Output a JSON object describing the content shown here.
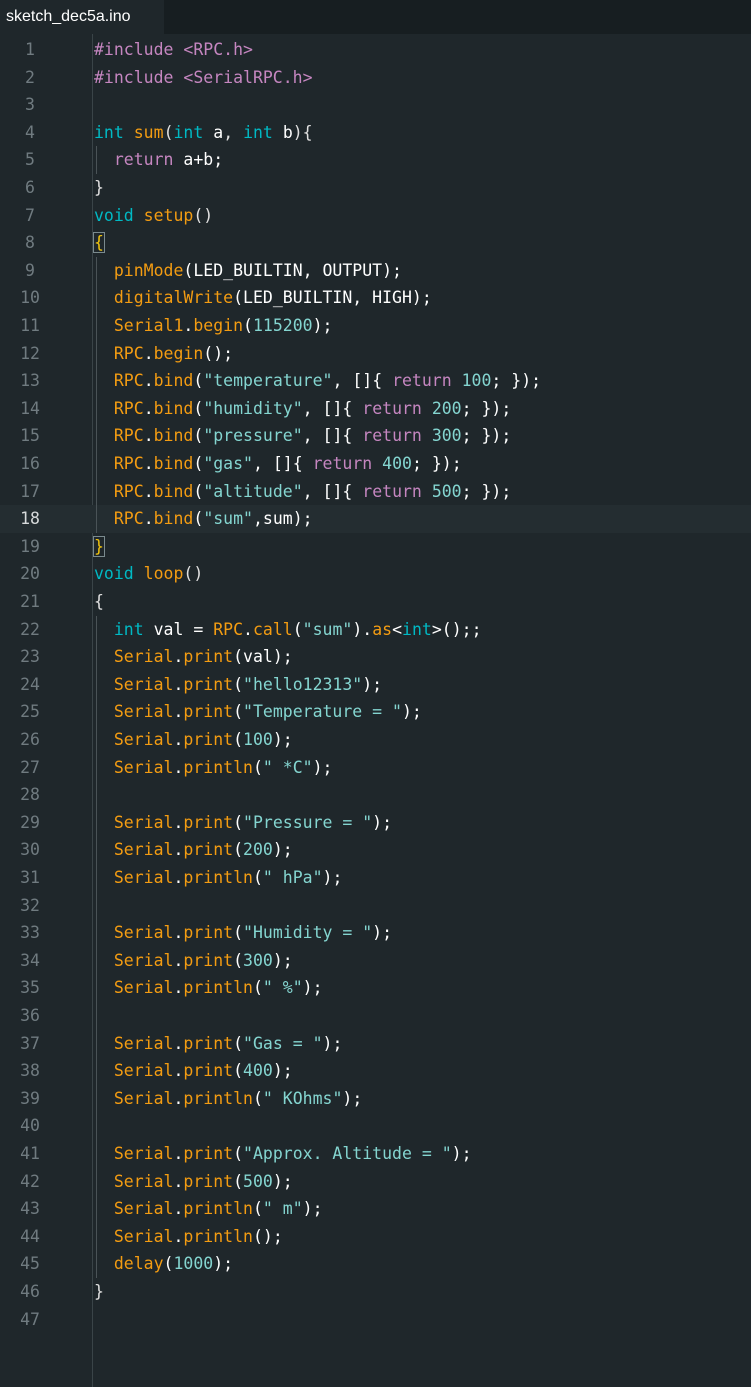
{
  "tab": {
    "title": "sketch_dec5a.ino"
  },
  "editor": {
    "active_line": 18,
    "lines": [
      [
        {
          "t": "#include <RPC.h>",
          "c": "pp"
        }
      ],
      [
        {
          "t": "#include <SerialRPC.h>",
          "c": "pp"
        }
      ],
      [],
      [
        {
          "t": "int ",
          "c": "kw"
        },
        {
          "t": "sum",
          "c": "fn"
        },
        {
          "t": "(",
          "c": "op"
        },
        {
          "t": "int ",
          "c": "kw"
        },
        {
          "t": "a",
          "c": "id"
        },
        {
          "t": ", ",
          "c": "op"
        },
        {
          "t": "int ",
          "c": "kw"
        },
        {
          "t": "b",
          "c": "id"
        },
        {
          "t": "){",
          "c": "op"
        }
      ],
      [
        {
          "t": "  ",
          "c": "op"
        },
        {
          "t": "return ",
          "c": "rt"
        },
        {
          "t": "a+b;",
          "c": "id"
        }
      ],
      [
        {
          "t": "}",
          "c": "op"
        }
      ],
      [
        {
          "t": "void ",
          "c": "kw"
        },
        {
          "t": "setup",
          "c": "fn"
        },
        {
          "t": "()",
          "c": "op"
        }
      ],
      [
        {
          "t": "{",
          "c": "bk"
        }
      ],
      [
        {
          "t": "  ",
          "c": "op"
        },
        {
          "t": "pinMode",
          "c": "fn"
        },
        {
          "t": "(LED_BUILTIN, OUTPUT);",
          "c": "id"
        }
      ],
      [
        {
          "t": "  ",
          "c": "op"
        },
        {
          "t": "digitalWrite",
          "c": "fn"
        },
        {
          "t": "(LED_BUILTIN, HIGH);",
          "c": "id"
        }
      ],
      [
        {
          "t": "  ",
          "c": "op"
        },
        {
          "t": "Serial1",
          "c": "fn"
        },
        {
          "t": ".",
          "c": "id"
        },
        {
          "t": "begin",
          "c": "fn"
        },
        {
          "t": "(",
          "c": "id"
        },
        {
          "t": "115200",
          "c": "num"
        },
        {
          "t": ");",
          "c": "id"
        }
      ],
      [
        {
          "t": "  ",
          "c": "op"
        },
        {
          "t": "RPC",
          "c": "fn"
        },
        {
          "t": ".",
          "c": "id"
        },
        {
          "t": "begin",
          "c": "fn"
        },
        {
          "t": "();",
          "c": "id"
        }
      ],
      [
        {
          "t": "  ",
          "c": "op"
        },
        {
          "t": "RPC",
          "c": "fn"
        },
        {
          "t": ".",
          "c": "id"
        },
        {
          "t": "bind",
          "c": "fn"
        },
        {
          "t": "(",
          "c": "id"
        },
        {
          "t": "\"temperature\"",
          "c": "str"
        },
        {
          "t": ", []{ ",
          "c": "id"
        },
        {
          "t": "return ",
          "c": "rt"
        },
        {
          "t": "100",
          "c": "num"
        },
        {
          "t": "; });",
          "c": "id"
        }
      ],
      [
        {
          "t": "  ",
          "c": "op"
        },
        {
          "t": "RPC",
          "c": "fn"
        },
        {
          "t": ".",
          "c": "id"
        },
        {
          "t": "bind",
          "c": "fn"
        },
        {
          "t": "(",
          "c": "id"
        },
        {
          "t": "\"humidity\"",
          "c": "str"
        },
        {
          "t": ", []{ ",
          "c": "id"
        },
        {
          "t": "return ",
          "c": "rt"
        },
        {
          "t": "200",
          "c": "num"
        },
        {
          "t": "; });",
          "c": "id"
        }
      ],
      [
        {
          "t": "  ",
          "c": "op"
        },
        {
          "t": "RPC",
          "c": "fn"
        },
        {
          "t": ".",
          "c": "id"
        },
        {
          "t": "bind",
          "c": "fn"
        },
        {
          "t": "(",
          "c": "id"
        },
        {
          "t": "\"pressure\"",
          "c": "str"
        },
        {
          "t": ", []{ ",
          "c": "id"
        },
        {
          "t": "return ",
          "c": "rt"
        },
        {
          "t": "300",
          "c": "num"
        },
        {
          "t": "; });",
          "c": "id"
        }
      ],
      [
        {
          "t": "  ",
          "c": "op"
        },
        {
          "t": "RPC",
          "c": "fn"
        },
        {
          "t": ".",
          "c": "id"
        },
        {
          "t": "bind",
          "c": "fn"
        },
        {
          "t": "(",
          "c": "id"
        },
        {
          "t": "\"gas\"",
          "c": "str"
        },
        {
          "t": ", []{ ",
          "c": "id"
        },
        {
          "t": "return ",
          "c": "rt"
        },
        {
          "t": "400",
          "c": "num"
        },
        {
          "t": "; });",
          "c": "id"
        }
      ],
      [
        {
          "t": "  ",
          "c": "op"
        },
        {
          "t": "RPC",
          "c": "fn"
        },
        {
          "t": ".",
          "c": "id"
        },
        {
          "t": "bind",
          "c": "fn"
        },
        {
          "t": "(",
          "c": "id"
        },
        {
          "t": "\"altitude\"",
          "c": "str"
        },
        {
          "t": ", []{ ",
          "c": "id"
        },
        {
          "t": "return ",
          "c": "rt"
        },
        {
          "t": "500",
          "c": "num"
        },
        {
          "t": "; });",
          "c": "id"
        }
      ],
      [
        {
          "t": "  ",
          "c": "op"
        },
        {
          "t": "RPC",
          "c": "fn"
        },
        {
          "t": ".",
          "c": "id"
        },
        {
          "t": "bind",
          "c": "fn"
        },
        {
          "t": "(",
          "c": "id"
        },
        {
          "t": "\"sum\"",
          "c": "str"
        },
        {
          "t": ",sum);",
          "c": "id"
        }
      ],
      [
        {
          "t": "}",
          "c": "bk"
        }
      ],
      [
        {
          "t": "void ",
          "c": "kw"
        },
        {
          "t": "loop",
          "c": "fn"
        },
        {
          "t": "()",
          "c": "op"
        }
      ],
      [
        {
          "t": "{",
          "c": "op"
        }
      ],
      [
        {
          "t": "  ",
          "c": "op"
        },
        {
          "t": "int ",
          "c": "kw"
        },
        {
          "t": "val = ",
          "c": "id"
        },
        {
          "t": "RPC",
          "c": "fn"
        },
        {
          "t": ".",
          "c": "id"
        },
        {
          "t": "call",
          "c": "fn"
        },
        {
          "t": "(",
          "c": "id"
        },
        {
          "t": "\"sum\"",
          "c": "str"
        },
        {
          "t": ").",
          "c": "id"
        },
        {
          "t": "as",
          "c": "fn"
        },
        {
          "t": "<",
          "c": "id"
        },
        {
          "t": "int",
          "c": "kw"
        },
        {
          "t": ">();;",
          "c": "id"
        }
      ],
      [
        {
          "t": "  ",
          "c": "op"
        },
        {
          "t": "Serial",
          "c": "fn"
        },
        {
          "t": ".",
          "c": "id"
        },
        {
          "t": "print",
          "c": "fn"
        },
        {
          "t": "(val);",
          "c": "id"
        }
      ],
      [
        {
          "t": "  ",
          "c": "op"
        },
        {
          "t": "Serial",
          "c": "fn"
        },
        {
          "t": ".",
          "c": "id"
        },
        {
          "t": "print",
          "c": "fn"
        },
        {
          "t": "(",
          "c": "id"
        },
        {
          "t": "\"hello12313\"",
          "c": "str"
        },
        {
          "t": ");",
          "c": "id"
        }
      ],
      [
        {
          "t": "  ",
          "c": "op"
        },
        {
          "t": "Serial",
          "c": "fn"
        },
        {
          "t": ".",
          "c": "id"
        },
        {
          "t": "print",
          "c": "fn"
        },
        {
          "t": "(",
          "c": "id"
        },
        {
          "t": "\"Temperature = \"",
          "c": "str"
        },
        {
          "t": ");",
          "c": "id"
        }
      ],
      [
        {
          "t": "  ",
          "c": "op"
        },
        {
          "t": "Serial",
          "c": "fn"
        },
        {
          "t": ".",
          "c": "id"
        },
        {
          "t": "print",
          "c": "fn"
        },
        {
          "t": "(",
          "c": "id"
        },
        {
          "t": "100",
          "c": "num"
        },
        {
          "t": ");",
          "c": "id"
        }
      ],
      [
        {
          "t": "  ",
          "c": "op"
        },
        {
          "t": "Serial",
          "c": "fn"
        },
        {
          "t": ".",
          "c": "id"
        },
        {
          "t": "println",
          "c": "fn"
        },
        {
          "t": "(",
          "c": "id"
        },
        {
          "t": "\" *C\"",
          "c": "str"
        },
        {
          "t": ");",
          "c": "id"
        }
      ],
      [],
      [
        {
          "t": "  ",
          "c": "op"
        },
        {
          "t": "Serial",
          "c": "fn"
        },
        {
          "t": ".",
          "c": "id"
        },
        {
          "t": "print",
          "c": "fn"
        },
        {
          "t": "(",
          "c": "id"
        },
        {
          "t": "\"Pressure = \"",
          "c": "str"
        },
        {
          "t": ");",
          "c": "id"
        }
      ],
      [
        {
          "t": "  ",
          "c": "op"
        },
        {
          "t": "Serial",
          "c": "fn"
        },
        {
          "t": ".",
          "c": "id"
        },
        {
          "t": "print",
          "c": "fn"
        },
        {
          "t": "(",
          "c": "id"
        },
        {
          "t": "200",
          "c": "num"
        },
        {
          "t": ");",
          "c": "id"
        }
      ],
      [
        {
          "t": "  ",
          "c": "op"
        },
        {
          "t": "Serial",
          "c": "fn"
        },
        {
          "t": ".",
          "c": "id"
        },
        {
          "t": "println",
          "c": "fn"
        },
        {
          "t": "(",
          "c": "id"
        },
        {
          "t": "\" hPa\"",
          "c": "str"
        },
        {
          "t": ");",
          "c": "id"
        }
      ],
      [],
      [
        {
          "t": "  ",
          "c": "op"
        },
        {
          "t": "Serial",
          "c": "fn"
        },
        {
          "t": ".",
          "c": "id"
        },
        {
          "t": "print",
          "c": "fn"
        },
        {
          "t": "(",
          "c": "id"
        },
        {
          "t": "\"Humidity = \"",
          "c": "str"
        },
        {
          "t": ");",
          "c": "id"
        }
      ],
      [
        {
          "t": "  ",
          "c": "op"
        },
        {
          "t": "Serial",
          "c": "fn"
        },
        {
          "t": ".",
          "c": "id"
        },
        {
          "t": "print",
          "c": "fn"
        },
        {
          "t": "(",
          "c": "id"
        },
        {
          "t": "300",
          "c": "num"
        },
        {
          "t": ");",
          "c": "id"
        }
      ],
      [
        {
          "t": "  ",
          "c": "op"
        },
        {
          "t": "Serial",
          "c": "fn"
        },
        {
          "t": ".",
          "c": "id"
        },
        {
          "t": "println",
          "c": "fn"
        },
        {
          "t": "(",
          "c": "id"
        },
        {
          "t": "\" %\"",
          "c": "str"
        },
        {
          "t": ");",
          "c": "id"
        }
      ],
      [],
      [
        {
          "t": "  ",
          "c": "op"
        },
        {
          "t": "Serial",
          "c": "fn"
        },
        {
          "t": ".",
          "c": "id"
        },
        {
          "t": "print",
          "c": "fn"
        },
        {
          "t": "(",
          "c": "id"
        },
        {
          "t": "\"Gas = \"",
          "c": "str"
        },
        {
          "t": ");",
          "c": "id"
        }
      ],
      [
        {
          "t": "  ",
          "c": "op"
        },
        {
          "t": "Serial",
          "c": "fn"
        },
        {
          "t": ".",
          "c": "id"
        },
        {
          "t": "print",
          "c": "fn"
        },
        {
          "t": "(",
          "c": "id"
        },
        {
          "t": "400",
          "c": "num"
        },
        {
          "t": ");",
          "c": "id"
        }
      ],
      [
        {
          "t": "  ",
          "c": "op"
        },
        {
          "t": "Serial",
          "c": "fn"
        },
        {
          "t": ".",
          "c": "id"
        },
        {
          "t": "println",
          "c": "fn"
        },
        {
          "t": "(",
          "c": "id"
        },
        {
          "t": "\" KOhms\"",
          "c": "str"
        },
        {
          "t": ");",
          "c": "id"
        }
      ],
      [],
      [
        {
          "t": "  ",
          "c": "op"
        },
        {
          "t": "Serial",
          "c": "fn"
        },
        {
          "t": ".",
          "c": "id"
        },
        {
          "t": "print",
          "c": "fn"
        },
        {
          "t": "(",
          "c": "id"
        },
        {
          "t": "\"Approx. Altitude = \"",
          "c": "str"
        },
        {
          "t": ");",
          "c": "id"
        }
      ],
      [
        {
          "t": "  ",
          "c": "op"
        },
        {
          "t": "Serial",
          "c": "fn"
        },
        {
          "t": ".",
          "c": "id"
        },
        {
          "t": "print",
          "c": "fn"
        },
        {
          "t": "(",
          "c": "id"
        },
        {
          "t": "500",
          "c": "num"
        },
        {
          "t": ");",
          "c": "id"
        }
      ],
      [
        {
          "t": "  ",
          "c": "op"
        },
        {
          "t": "Serial",
          "c": "fn"
        },
        {
          "t": ".",
          "c": "id"
        },
        {
          "t": "println",
          "c": "fn"
        },
        {
          "t": "(",
          "c": "id"
        },
        {
          "t": "\" m\"",
          "c": "str"
        },
        {
          "t": ");",
          "c": "id"
        }
      ],
      [
        {
          "t": "  ",
          "c": "op"
        },
        {
          "t": "Serial",
          "c": "fn"
        },
        {
          "t": ".",
          "c": "id"
        },
        {
          "t": "println",
          "c": "fn"
        },
        {
          "t": "();",
          "c": "id"
        }
      ],
      [
        {
          "t": "  ",
          "c": "op"
        },
        {
          "t": "delay",
          "c": "fn"
        },
        {
          "t": "(",
          "c": "id"
        },
        {
          "t": "1000",
          "c": "num"
        },
        {
          "t": ");",
          "c": "id"
        }
      ],
      [
        {
          "t": "}",
          "c": "op"
        }
      ],
      []
    ]
  },
  "colors": {
    "background": "#1f272b",
    "tabbar": "#171e21",
    "keyword": "#00b9c4",
    "function": "#f39c12",
    "string": "#84d5d0",
    "preprocessor": "#c586c0"
  }
}
